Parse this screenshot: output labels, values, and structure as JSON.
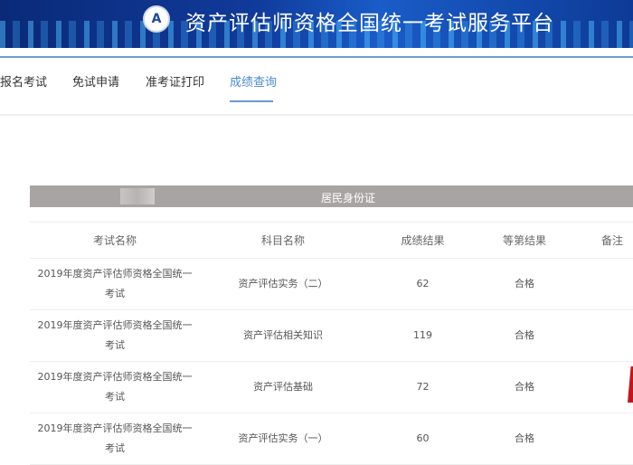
{
  "header": {
    "title": "资产评估师资格全国统一考试服务平台",
    "logo_icon": "association-seal-icon"
  },
  "nav": {
    "items": [
      {
        "label": "报名考试"
      },
      {
        "label": "免试申请"
      },
      {
        "label": "准考证打印"
      },
      {
        "label": "成绩查询",
        "active": true
      }
    ]
  },
  "id_bar": {
    "label": "居民身份证"
  },
  "table": {
    "headers": [
      "考试名称",
      "科目名称",
      "成绩结果",
      "等第结果",
      "备注"
    ],
    "rows": [
      {
        "exam": "2019年度资产评估师资格全国统一考试",
        "subject": "资产评估实务（二）",
        "score": "62",
        "grade": "合格",
        "note": ""
      },
      {
        "exam": "2019年度资产评估师资格全国统一考试",
        "subject": "资产评估相关知识",
        "score": "119",
        "grade": "合格",
        "note": ""
      },
      {
        "exam": "2019年度资产评估师资格全国统一考试",
        "subject": "资产评估基础",
        "score": "72",
        "grade": "合格",
        "note": ""
      },
      {
        "exam": "2019年度资产评估师资格全国统一考试",
        "subject": "资产评估实务（一）",
        "score": "60",
        "grade": "合格",
        "note": ""
      }
    ]
  },
  "colors": {
    "banner": "#0d3a96",
    "accent": "#4a8ad0",
    "id_bar": "#a9a4a4"
  }
}
